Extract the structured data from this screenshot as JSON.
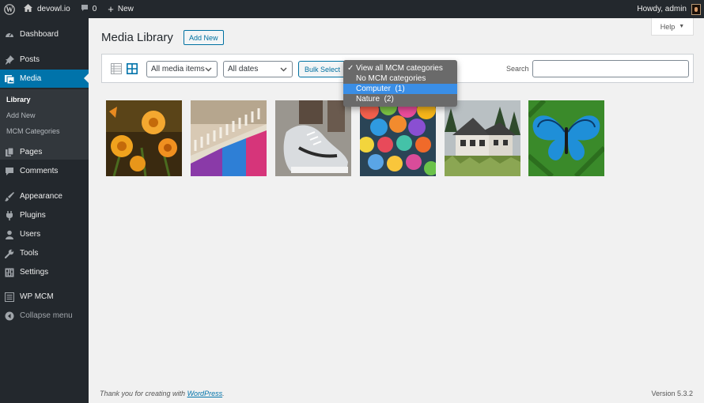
{
  "adminbar": {
    "site_name": "devowl.io",
    "comments_count": "0",
    "new_label": "New",
    "greeting": "Howdy, admin"
  },
  "sidebar": {
    "items": [
      {
        "label": "Dashboard",
        "icon": "dashboard-icon"
      },
      {
        "label": "Posts",
        "icon": "pin-icon"
      },
      {
        "label": "Media",
        "icon": "media-icon"
      },
      {
        "label": "Pages",
        "icon": "pages-icon"
      },
      {
        "label": "Comments",
        "icon": "comment-icon"
      },
      {
        "label": "Appearance",
        "icon": "brush-icon"
      },
      {
        "label": "Plugins",
        "icon": "plugin-icon"
      },
      {
        "label": "Users",
        "icon": "users-icon"
      },
      {
        "label": "Tools",
        "icon": "wrench-icon"
      },
      {
        "label": "Settings",
        "icon": "settings-icon"
      },
      {
        "label": "WP MCM",
        "icon": "list-icon"
      },
      {
        "label": "Collapse menu",
        "icon": "collapse-icon"
      }
    ],
    "submenu": [
      {
        "label": "Library"
      },
      {
        "label": "Add New"
      },
      {
        "label": "MCM Categories"
      }
    ]
  },
  "header": {
    "help_label": "Help",
    "title": "Media Library",
    "add_new_label": "Add New"
  },
  "toolbar": {
    "media_filter": "All media items",
    "date_filter": "All dates",
    "bulk_select_label": "Bulk Select",
    "search_label": "Search",
    "search_value": ""
  },
  "category_dropdown": {
    "options": [
      {
        "label": "View all MCM categories",
        "checked": true
      },
      {
        "label": "No MCM categories"
      },
      {
        "label": "Computer  (1)",
        "highlighted": true
      },
      {
        "label": "Nature  (2)"
      }
    ]
  },
  "media_items": [
    {
      "icon": "flowers-photo"
    },
    {
      "icon": "rainbow-stairs-photo"
    },
    {
      "icon": "sneaker-photo"
    },
    {
      "icon": "umbrellas-photo"
    },
    {
      "icon": "house-photo"
    },
    {
      "icon": "butterfly-photo"
    }
  ],
  "footer": {
    "thanks_prefix": "Thank you for creating with ",
    "wordpress_link": "WordPress",
    "thanks_suffix": ".",
    "version": "Version 5.3.2"
  },
  "colors": {
    "admin_bar": "#23282d",
    "active_menu": "#0073aa",
    "link": "#0071a1",
    "dropdown_highlight": "#3a8ee6"
  }
}
